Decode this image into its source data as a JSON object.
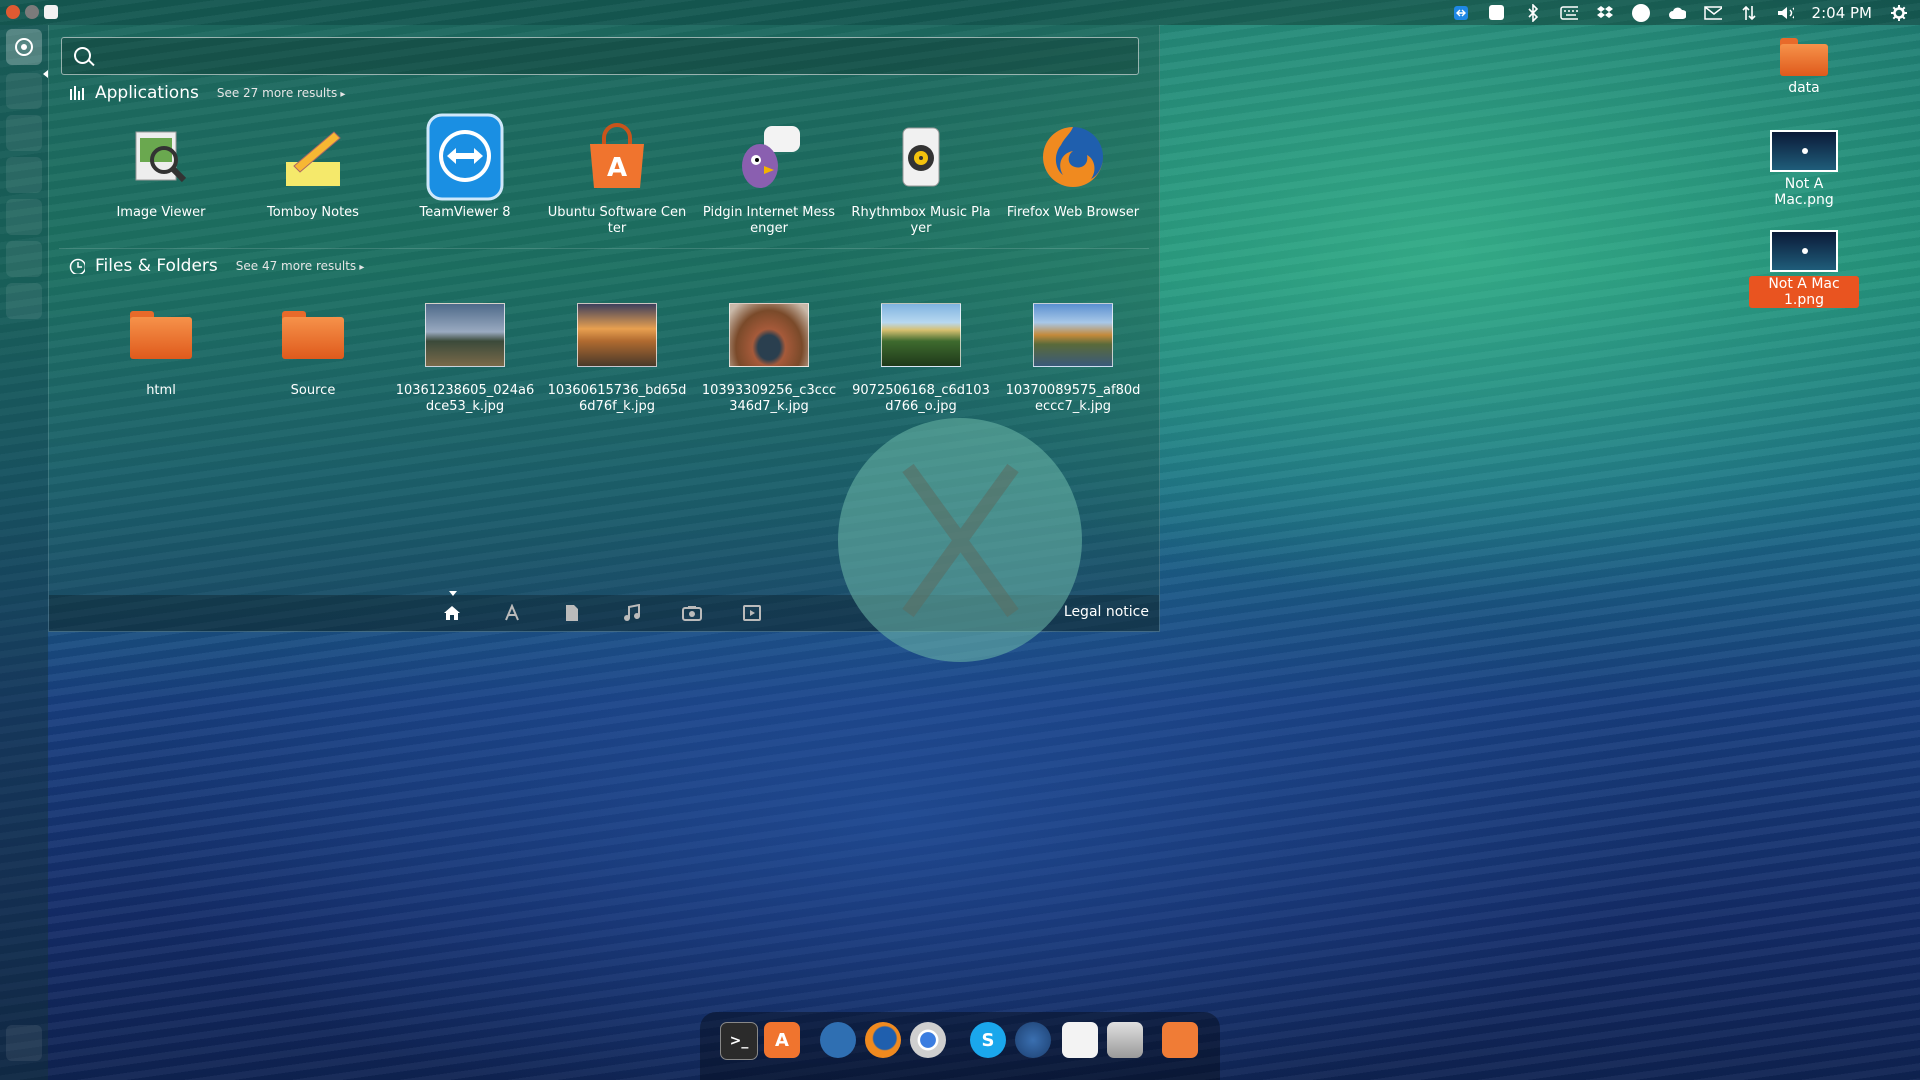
{
  "topbar": {
    "clock": "2:04 PM",
    "indicators": [
      "teamviewer-icon",
      "box-icon",
      "bluetooth-icon",
      "keyboard-icon",
      "dropbox-icon",
      "circle-icon",
      "cloud-icon",
      "mail-icon",
      "network-icon",
      "volume-icon"
    ]
  },
  "dash": {
    "search": {
      "value": "",
      "placeholder": ""
    },
    "applications": {
      "title": "Applications",
      "more": "See 27 more results",
      "items": [
        {
          "label": "Image Viewer"
        },
        {
          "label": "Tomboy Notes"
        },
        {
          "label": "TeamViewer 8"
        },
        {
          "label": "Ubuntu Software Center"
        },
        {
          "label": "Pidgin Internet Messenger"
        },
        {
          "label": "Rhythmbox Music Player"
        },
        {
          "label": "Firefox Web Browser"
        }
      ]
    },
    "files": {
      "title": "Files & Folders",
      "more": "See 47 more results",
      "items": [
        {
          "label": "html"
        },
        {
          "label": "Source"
        },
        {
          "label": "10361238605_024a6dce53_k.jpg"
        },
        {
          "label": "10360615736_bd65d6d76f_k.jpg"
        },
        {
          "label": "10393309256_c3ccc346d7_k.jpg"
        },
        {
          "label": "9072506168_c6d103d766_o.jpg"
        },
        {
          "label": "10370089575_af80deccc7_k.jpg"
        }
      ]
    },
    "lensbar": {
      "legal": "Legal notice"
    }
  },
  "desktop": {
    "icons": [
      {
        "label": "data"
      },
      {
        "label": "Not A Mac.png"
      },
      {
        "label": "Not A Mac 1.png"
      }
    ]
  },
  "colors": {
    "accent": "#e95420",
    "folder": "#f07c36"
  }
}
